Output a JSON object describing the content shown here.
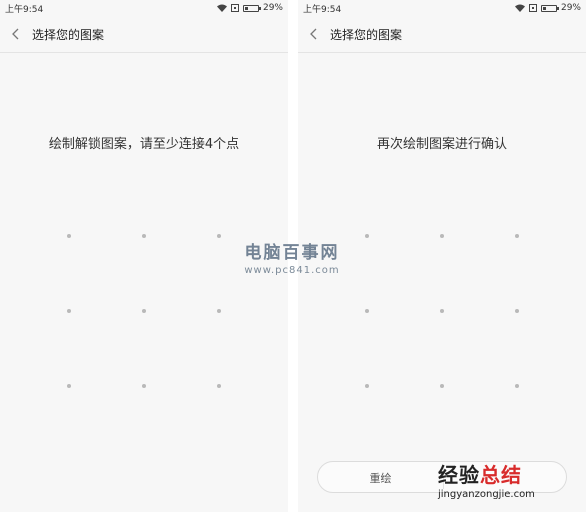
{
  "left_screen": {
    "status": {
      "time": "上午9:54",
      "battery": "29%",
      "battery_level": 0.29
    },
    "title": "选择您的图案",
    "instruction": "绘制解锁图案，请至少连接4个点",
    "grid": {
      "rows": 3,
      "cols": 3
    }
  },
  "right_screen": {
    "status": {
      "time": "上午9:54",
      "battery": "29%",
      "battery_level": 0.29
    },
    "title": "选择您的图案",
    "instruction": "再次绘制图案进行确认",
    "grid": {
      "rows": 3,
      "cols": 3
    },
    "redraw_label": "重绘"
  },
  "watermark_center": {
    "title": "电脑百事网",
    "url": "www.pc841.com"
  },
  "watermark_corner": {
    "title_a": "经验",
    "title_b": "总结",
    "url": "jingyanzongjie.com"
  },
  "icons": [
    "back-chevron-icon",
    "wifi-icon",
    "sim-icon",
    "battery-icon"
  ],
  "colors": {
    "background": "#f7f7f7",
    "dot": "#b9b9b9",
    "text": "#333333",
    "watermark_red": "#d82b2b"
  }
}
